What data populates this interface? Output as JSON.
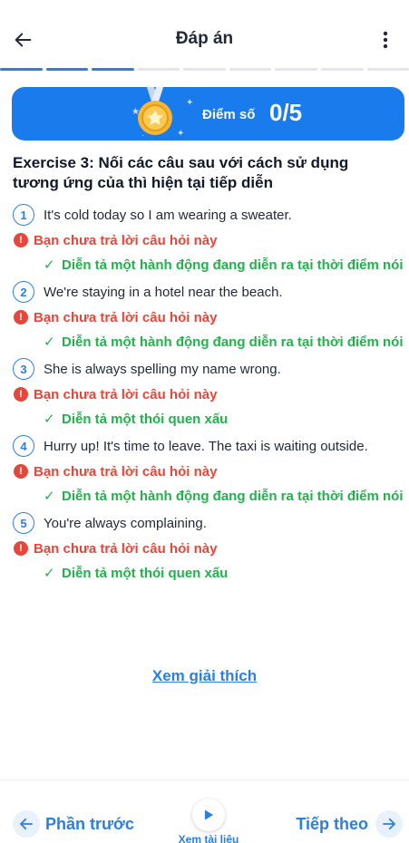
{
  "header": {
    "title": "Đáp án"
  },
  "progress": {
    "total": 9,
    "completed": 3
  },
  "score": {
    "label": "Điểm số",
    "value": "0/5"
  },
  "exercise": {
    "title": "Exercise 3: Nối các câu sau với cách sử dụng tương ứng của thì hiện tại tiếp diễn"
  },
  "questions": [
    {
      "number": "1",
      "text": "It's cold today so I am wearing a sweater.",
      "status": "Bạn chưa trả lời câu hỏi này",
      "answer": "Diễn tả một hành động đang diễn ra tại thời điểm nói"
    },
    {
      "number": "2",
      "text": "We're staying in a hotel near the beach.",
      "status": "Bạn chưa trả lời câu hỏi này",
      "answer": "Diễn tả một hành động đang diễn ra tại thời điểm nói"
    },
    {
      "number": "3",
      "text": "She is always spelling my name wrong.",
      "status": "Bạn chưa trả lời câu hỏi này",
      "answer": "Diễn tả một thói quen xấu"
    },
    {
      "number": "4",
      "text": "Hurry up! It's time to leave. The taxi is waiting outside.",
      "status": "Bạn chưa trả lời câu hỏi này",
      "answer": "Diễn tả một hành động đang diễn ra tại thời điểm nói"
    },
    {
      "number": "5",
      "text": "You're always complaining.",
      "status": "Bạn chưa trả lời câu hỏi này",
      "answer": "Diễn tả một thói quen xấu"
    }
  ],
  "explain_link": "Xem giải thích",
  "footer": {
    "prev_label": "Phần trước",
    "docs_label": "Xem tài liệu",
    "next_label": "Tiếp theo"
  },
  "colors": {
    "primary": "#1a7bec",
    "error": "#e5483a",
    "success": "#22b24c"
  },
  "icons": {
    "back": "arrow-left-icon",
    "more": "more-vertical-icon",
    "medal": "medal-icon",
    "error": "error-circle-icon",
    "check": "check-icon",
    "play": "play-icon",
    "next": "arrow-right-icon"
  }
}
